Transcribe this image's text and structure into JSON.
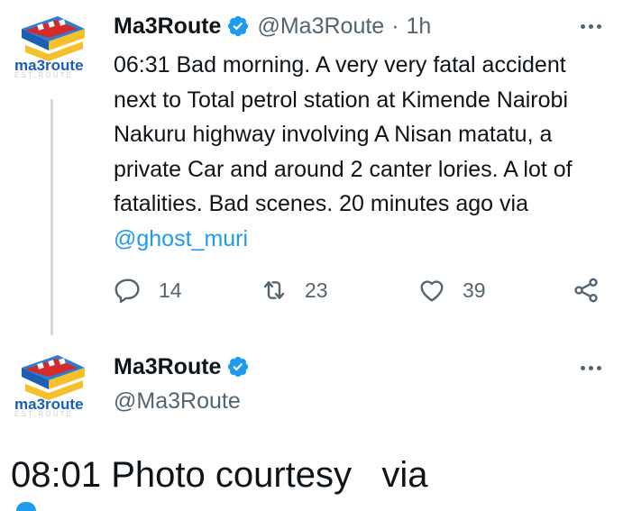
{
  "tweets": [
    {
      "avatar_text": "ma3route",
      "name": "Ma3Route",
      "handle": "@Ma3Route",
      "separator": "·",
      "time": "1h",
      "text_main": "06:31 Bad morning. A very very fatal accident next to Total petrol station at Kimende Nairobi Nakuru highway involving A Nisan matatu, a private Car and around 2 canter lories. A lot of fatalities. Bad scenes. 20 minutes ago via ",
      "mention": "@ghost_muri",
      "replies": "14",
      "retweets": "23",
      "likes": "39"
    },
    {
      "avatar_text": "ma3route",
      "name": "Ma3Route",
      "handle": "@Ma3Route"
    }
  ],
  "focused_text": "08:01 Photo courtesy   via",
  "colors": {
    "accent": "#1d9bf0",
    "secondary_text": "#536471",
    "primary_text": "#0f1419",
    "logo_blue": "#1a5fb4",
    "logo_red": "#e01b24",
    "logo_yellow": "#f6c02c"
  },
  "icons": [
    "verified-badge-icon",
    "more-icon",
    "reply-icon",
    "retweet-icon",
    "like-icon",
    "share-icon"
  ]
}
